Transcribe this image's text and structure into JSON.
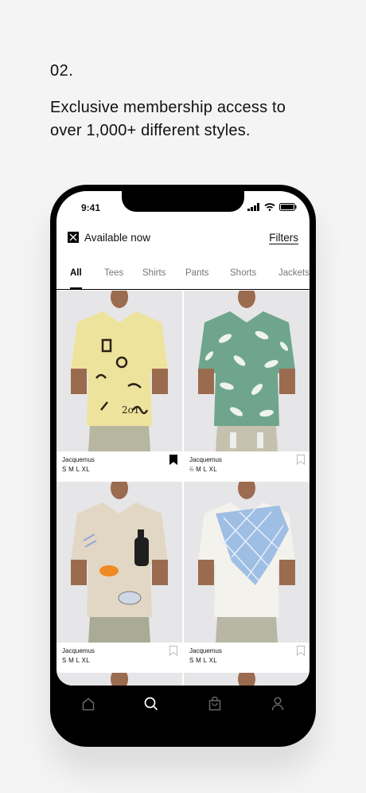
{
  "intro": {
    "step": "02.",
    "headline": "Exclusive membership access to over 1,000+ different styles."
  },
  "status": {
    "time": "9:41"
  },
  "header": {
    "availability": "Available now",
    "filters": "Filters"
  },
  "tabs": [
    "All",
    "Tees",
    "Shirts",
    "Pants",
    "Shorts",
    "Jackets"
  ],
  "active_tab": "All",
  "products": [
    {
      "brand": "Jacquemus",
      "sizes": "S M L XL",
      "unavailable_size": "",
      "bookmarked": true,
      "shirt_color": "#efe7a2",
      "pattern": "yellow-print"
    },
    {
      "brand": "Jacquemus",
      "sizes": "M L XL",
      "unavailable_size": "S",
      "bookmarked": false,
      "shirt_color": "#6fa58c",
      "pattern": "leaf-print"
    },
    {
      "brand": "Jacquemus",
      "sizes": "S M L XL",
      "unavailable_size": "",
      "bookmarked": false,
      "shirt_color": "#e2d7c4",
      "pattern": "still-life-print"
    },
    {
      "brand": "Jacquemus",
      "sizes": "S M L XL",
      "unavailable_size": "",
      "bookmarked": false,
      "shirt_color": "#f4f2ec",
      "pattern": "blue-grid-print"
    }
  ],
  "bottom_nav": [
    {
      "icon": "home-icon",
      "active": false
    },
    {
      "icon": "search-icon",
      "active": true
    },
    {
      "icon": "bag-icon",
      "active": false
    },
    {
      "icon": "profile-icon",
      "active": false
    }
  ]
}
